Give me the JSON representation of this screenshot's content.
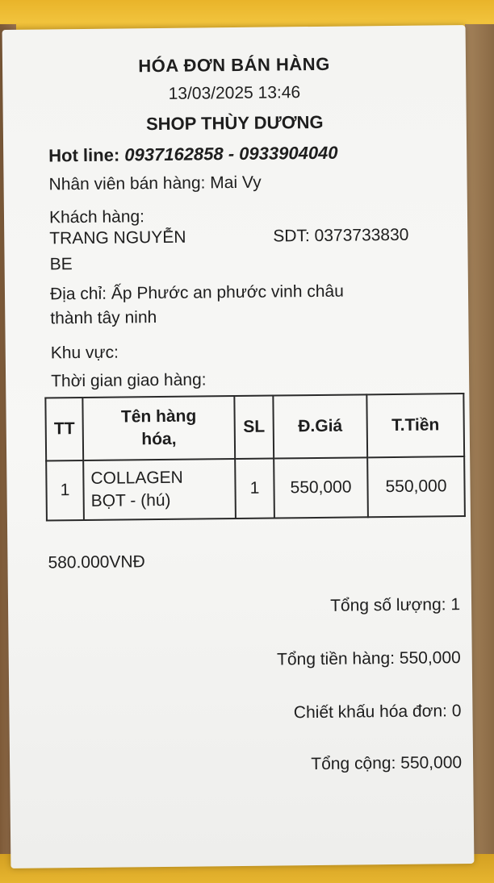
{
  "receipt": {
    "title": "HÓA ĐƠN BÁN HÀNG",
    "datetime": "13/03/2025 13:46",
    "shop_name": "SHOP THÙY DƯƠNG",
    "hotline_label": "Hot line:",
    "hotline_numbers": "0937162858 - 0933904040",
    "staff": "Nhân viên bán hàng: Mai Vy",
    "customer_label": "Khách hàng:",
    "customer_name_line1": "TRANG NGUYỄN",
    "customer_name_line2": "BE",
    "customer_phone": "SDT: 0373733830",
    "address_line1": "Địa chỉ: Ấp Phước an phước vinh châu",
    "address_line2": "thành tây ninh",
    "area": "Khu vực:",
    "delivery_time": "Thời gian giao hàng:",
    "table": {
      "headers": {
        "index": "TT",
        "name_line1": "Tên hàng",
        "name_line2": "hóa,",
        "qty": "SL",
        "price": "Đ.Giá",
        "amount": "T.Tiền"
      },
      "rows": [
        {
          "index": "1",
          "name_line1": "COLLAGEN",
          "name_line2": "BỌT - (hú)",
          "qty": "1",
          "price": "550,000",
          "amount": "550,000"
        }
      ]
    },
    "handwritten_note": "580.000VNĐ",
    "total_quantity": "Tổng số lượng: 1",
    "total_goods": "Tổng tiền hàng: 550,000",
    "discount": "Chiết khấu hóa đơn: 0",
    "grand_total": "Tổng cộng: 550,000"
  }
}
